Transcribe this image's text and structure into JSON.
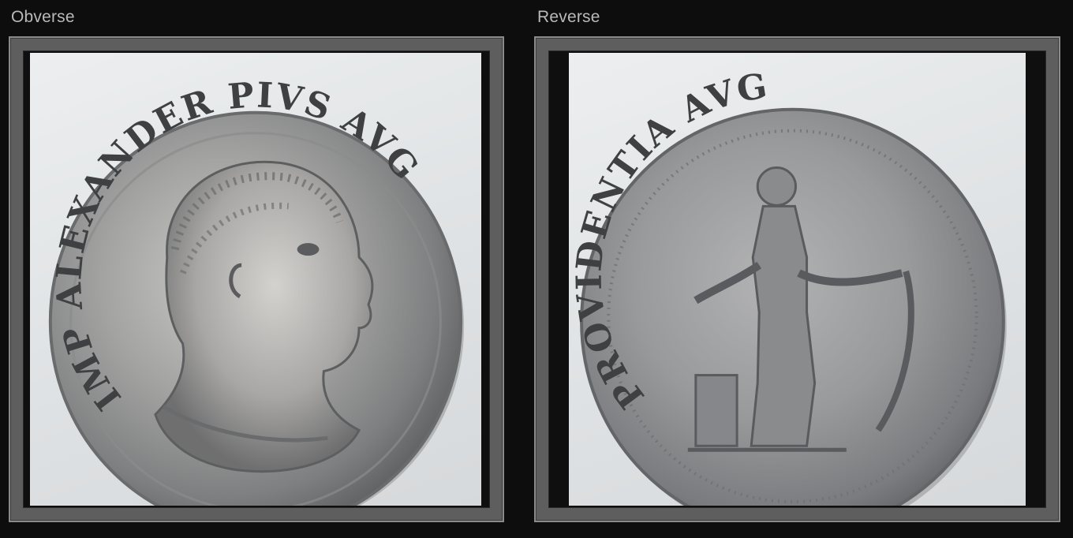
{
  "panels": {
    "obverse": {
      "label": "Obverse",
      "coin_legend": "IMP ALEXANDER PIVS AVG",
      "depiction": "laureate-bust-right"
    },
    "reverse": {
      "label": "Reverse",
      "coin_legend": "PROVIDENTIA AVG",
      "depiction": "standing-figure-with-cornucopia"
    }
  },
  "colors": {
    "page_background": "#0d0d0d",
    "frame": "#5e5e5e",
    "label_text": "#b9b9b9",
    "coin_silver": "#9c9d9f"
  }
}
